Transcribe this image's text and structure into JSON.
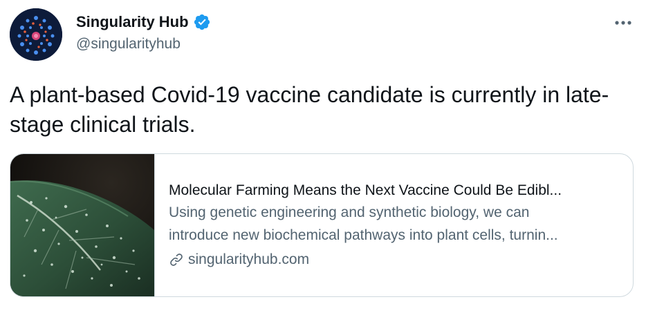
{
  "author": {
    "display_name": "Singularity Hub",
    "handle": "@singularityhub",
    "verified": true,
    "avatar_icon": "singularity-hub-logo",
    "verified_icon": "verified-badge-icon",
    "verified_color": "#1d9bf0"
  },
  "menu": {
    "icon": "more-horizontal-icon"
  },
  "tweet": {
    "text": "A plant-based Covid-19 vaccine candidate is currently in late-stage clinical trials."
  },
  "card": {
    "title": "Molecular Farming Means the Next Vaccine Could Be Edibl...",
    "description_line1": "Using genetic engineering and synthetic biology, we can",
    "description_line2": "introduce new biochemical pathways into plant cells, turnin...",
    "domain": "singularityhub.com",
    "link_icon": "link-icon",
    "image": "leaf-with-water-droplets"
  },
  "colors": {
    "text_primary": "#0f1419",
    "text_secondary": "#536471",
    "border": "#cfd9de"
  }
}
